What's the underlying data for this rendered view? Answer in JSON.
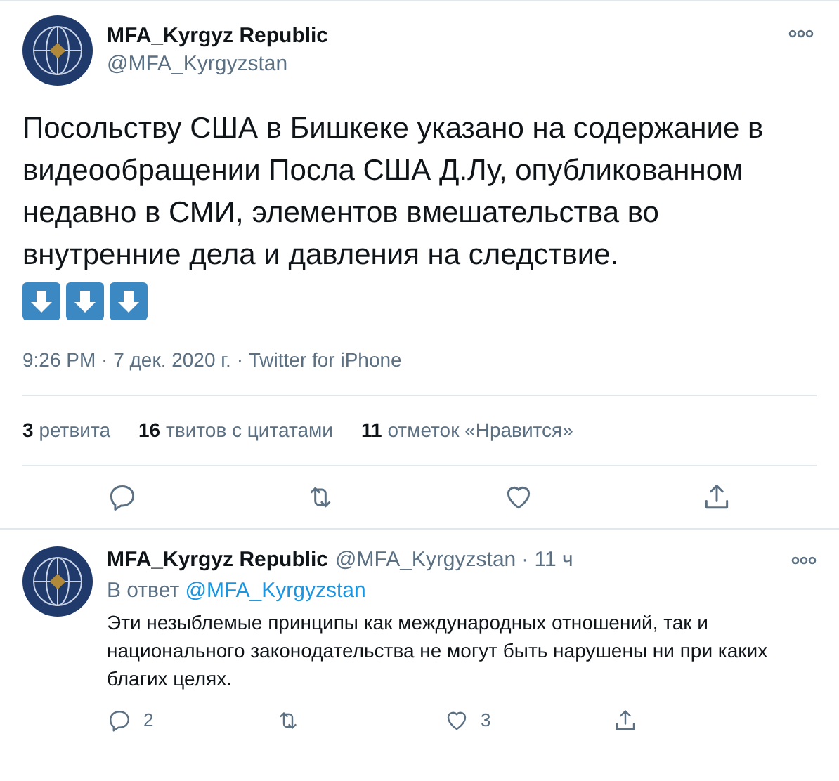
{
  "tweet": {
    "author": {
      "name": "MFA_Kyrgyz Republic",
      "handle": "@MFA_Kyrgyzstan"
    },
    "text": "Посольству США в Бишкеке указано на содержание в видеообращении Посла США Д.Лу, опубликованном недавно в СМИ, элементов вмешательства во внутренние дела и давления на следствие.",
    "emojis": [
      {
        "kind": "down-arrow"
      },
      {
        "kind": "down-arrow"
      },
      {
        "kind": "down-arrow"
      }
    ],
    "meta": "9:26 PM · 7 дек. 2020 г. · Twitter for iPhone",
    "stats": [
      {
        "count": "3",
        "label": "ретвита"
      },
      {
        "count": "16",
        "label": "твитов с цитатами"
      },
      {
        "count": "11",
        "label": "отметок «Нравится»"
      }
    ]
  },
  "reply": {
    "author": {
      "name": "MFA_Kyrgyz Republic",
      "handle": "@MFA_Kyrgyzstan"
    },
    "time": "· 11 ч",
    "reply_to": {
      "label": "В ответ",
      "handle": "@MFA_Kyrgyzstan"
    },
    "text": "Эти незыблемые принципы как международных отношений, так и национального законодательства не могут быть нарушены ни при каких благих целях.",
    "actions": [
      {
        "kind": "reply",
        "count": "2"
      },
      {
        "kind": "retweet"
      },
      {
        "kind": "like",
        "count": "3"
      },
      {
        "kind": "share"
      }
    ]
  }
}
